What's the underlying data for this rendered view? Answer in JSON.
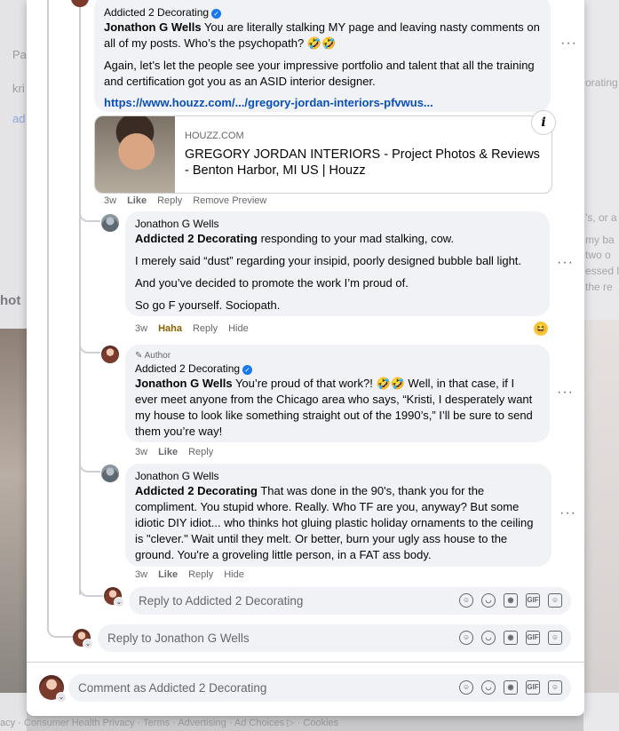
{
  "background": {
    "left_fragments": [
      "Pa",
      "kri",
      "ad",
      "hot"
    ],
    "right_fragments": [
      "orating",
      "'s, or a",
      "my ba",
      "two o",
      "essed li",
      "the re"
    ],
    "footer": "acy · Consumer Health Privacy · Terms · Advertising · Ad Choices ▷ · Cookies"
  },
  "comment_top": {
    "author": "Addicted 2 Decorating",
    "mention": "Jonathon G Wells",
    "text": " You are literally stalking MY page and leaving nasty comments on all of my posts. Who’s the psychopath? 🤣🤣",
    "para2": "Again, let’s let the people see your impressive portfolio and talent that all the training and certification got you as an ASID interior designer.",
    "link": "https://www.houzz.com/.../gregory-jordan-interiors-pfvwus...",
    "preview": {
      "domain": "HOUZZ.COM",
      "title": "GREGORY JORDAN INTERIORS - Project Photos & Reviews - Benton Harbor, MI US | Houzz"
    },
    "actions": {
      "time": "3w",
      "like": "Like",
      "reply": "Reply",
      "remove_preview": "Remove Preview"
    }
  },
  "reply1": {
    "author": "Jonathon G Wells",
    "mention": "Addicted 2 Decorating",
    "text": " responding to your mad stalking, cow.",
    "para2": "I merely said “dust” regarding your insipid, poorly designed bubble ball light.",
    "para3": "And you’ve decided to promote the work I’m proud of.",
    "para4": "So go F yourself. Sociopath.",
    "actions": {
      "time": "3w",
      "reaction": "Haha",
      "reply": "Reply",
      "hide": "Hide"
    },
    "reaction_emoji": "😆"
  },
  "reply2": {
    "author_tag": "Author",
    "author": "Addicted 2 Decorating",
    "mention": "Jonathon G Wells",
    "text": " You’re proud of that work?! 🤣🤣 Well, in that case, if I ever meet anyone from the Chicago area who says, “Kristi, I desperately want my house to look like something straight out of the 1990’s,” I’ll be sure to send them you’re way!",
    "actions": {
      "time": "3w",
      "like": "Like",
      "reply": "Reply"
    }
  },
  "reply3": {
    "author": "Jonathon G Wells",
    "mention": "Addicted 2 Decorating",
    "text": " That was done in the 90's, thank you for the compliment. You stupid whore. Really. Who TF are you, anyway? But some idiotic DIY idiot... who thinks hot gluing plastic holiday ornaments to the ceiling is \"clever.\" Wait until they melt. Or better, burn your ugly ass house to the ground. You're a groveling little person, in a FAT ass body.",
    "actions": {
      "time": "3w",
      "like": "Like",
      "reply": "Reply",
      "hide": "Hide"
    }
  },
  "inputs": {
    "reply_addicted": "Reply to Addicted 2 Decorating",
    "reply_jonathon": "Reply to Jonathon G Wells",
    "comment_as": "Comment as Addicted 2 Decorating"
  },
  "input_icons": [
    "avatar-sticker-icon",
    "emoji-icon",
    "camera-icon",
    "gif-icon",
    "sticker-icon"
  ],
  "gif_label": "GIF",
  "more_label": "···"
}
